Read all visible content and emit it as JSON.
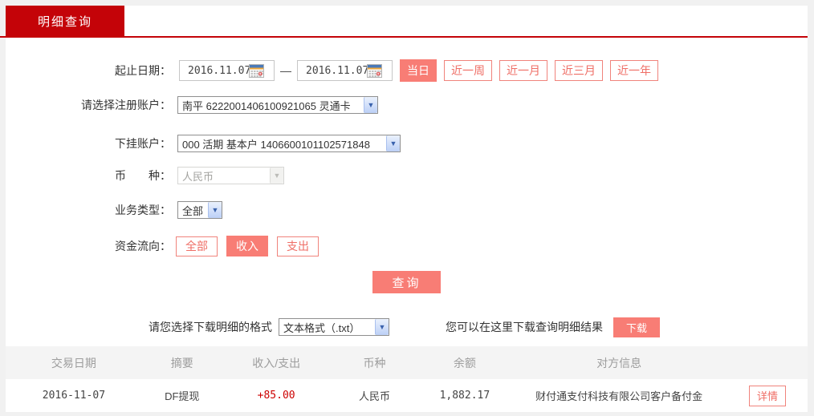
{
  "tab": {
    "label": "明细查询"
  },
  "form": {
    "date_range": {
      "label": "起止日期：",
      "start": "2016.11.07",
      "end": "2016.11.07",
      "separator": "—",
      "quick_buttons": [
        {
          "label": "当日",
          "active": true
        },
        {
          "label": "近一周",
          "active": false
        },
        {
          "label": "近一月",
          "active": false
        },
        {
          "label": "近三月",
          "active": false
        },
        {
          "label": "近一年",
          "active": false
        }
      ]
    },
    "register_account": {
      "label": "请选择注册账户：",
      "value": "南平 6222001406100921065 灵通卡"
    },
    "sub_account": {
      "label": "下挂账户：",
      "value": "000 活期 基本户 1406600101102571848"
    },
    "currency": {
      "label": "币　　种：",
      "value": "人民币",
      "disabled": true
    },
    "business_type": {
      "label": "业务类型：",
      "value": "全部"
    },
    "fund_flow": {
      "label": "资金流向：",
      "options": [
        {
          "label": "全部",
          "active": false
        },
        {
          "label": "收入",
          "active": true
        },
        {
          "label": "支出",
          "active": false
        }
      ]
    },
    "query_button": "查询"
  },
  "download": {
    "format_label": "请您选择下载明细的格式",
    "format_value": "文本格式（.txt）",
    "hint": "您可以在这里下载查询明细结果",
    "button": "下载"
  },
  "table": {
    "headers": [
      "交易日期",
      "摘要",
      "收入/支出",
      "币种",
      "余额",
      "对方信息"
    ],
    "rows": [
      {
        "date": "2016-11-07",
        "summary": "DF提现",
        "amount": "+85.00",
        "currency": "人民币",
        "balance": "1,882.17",
        "counterparty": "财付通支付科技有限公司客户备付金",
        "detail_button": "详情"
      }
    ]
  },
  "colors": {
    "accent_red": "#c40308",
    "salmon": "#f87d75",
    "outline_red": "#f0837c",
    "amount_red": "#cc0000"
  }
}
